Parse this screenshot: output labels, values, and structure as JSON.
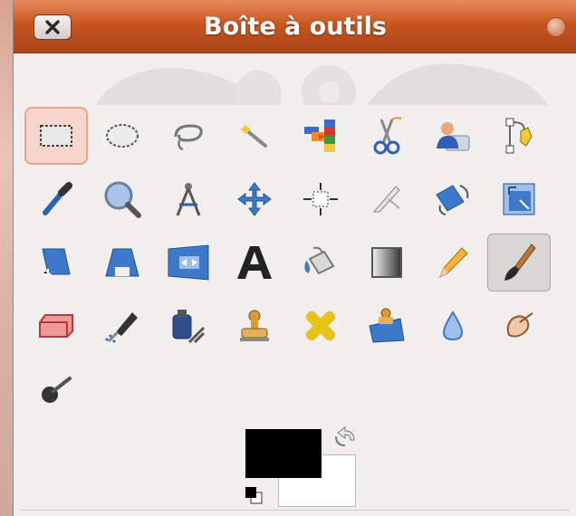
{
  "window": {
    "title": "Boîte à outils",
    "close_icon": "close-icon",
    "titlebar_color": "#c9561f"
  },
  "tools": [
    {
      "id": "rect-select",
      "icon": "rect-select-icon"
    },
    {
      "id": "ellipse-select",
      "icon": "ellipse-select-icon"
    },
    {
      "id": "free-select",
      "icon": "lasso-icon"
    },
    {
      "id": "fuzzy-select",
      "icon": "magic-wand-icon"
    },
    {
      "id": "select-by-color",
      "icon": "select-by-color-icon"
    },
    {
      "id": "scissors-select",
      "icon": "scissors-icon"
    },
    {
      "id": "foreground-select",
      "icon": "foreground-select-icon"
    },
    {
      "id": "paths",
      "icon": "paths-icon"
    },
    {
      "id": "color-picker",
      "icon": "eyedropper-icon"
    },
    {
      "id": "zoom",
      "icon": "magnifier-icon"
    },
    {
      "id": "measure",
      "icon": "compass-icon"
    },
    {
      "id": "move",
      "icon": "move-icon"
    },
    {
      "id": "align",
      "icon": "align-icon"
    },
    {
      "id": "crop",
      "icon": "scalpel-icon"
    },
    {
      "id": "rotate",
      "icon": "rotate-icon"
    },
    {
      "id": "scale",
      "icon": "scale-icon"
    },
    {
      "id": "shear",
      "icon": "shear-icon"
    },
    {
      "id": "perspective",
      "icon": "perspective-icon"
    },
    {
      "id": "flip",
      "icon": "flip-icon"
    },
    {
      "id": "text",
      "icon": "text-icon"
    },
    {
      "id": "bucket-fill",
      "icon": "bucket-icon"
    },
    {
      "id": "blend",
      "icon": "gradient-icon"
    },
    {
      "id": "pencil",
      "icon": "pencil-icon"
    },
    {
      "id": "paintbrush",
      "icon": "paintbrush-icon"
    },
    {
      "id": "eraser",
      "icon": "eraser-icon"
    },
    {
      "id": "airbrush",
      "icon": "airbrush-icon"
    },
    {
      "id": "ink",
      "icon": "ink-icon"
    },
    {
      "id": "clone",
      "icon": "stamp-icon"
    },
    {
      "id": "heal",
      "icon": "bandage-icon"
    },
    {
      "id": "perspective-clone",
      "icon": "perspective-clone-icon"
    },
    {
      "id": "blur-sharpen",
      "icon": "water-drop-icon"
    },
    {
      "id": "smudge",
      "icon": "smudge-icon"
    },
    {
      "id": "dodge-burn",
      "icon": "dodge-burn-icon"
    }
  ],
  "active_tools": [
    "rect-select",
    "paintbrush"
  ],
  "colors": {
    "foreground": "#000000",
    "background": "#ffffff"
  }
}
